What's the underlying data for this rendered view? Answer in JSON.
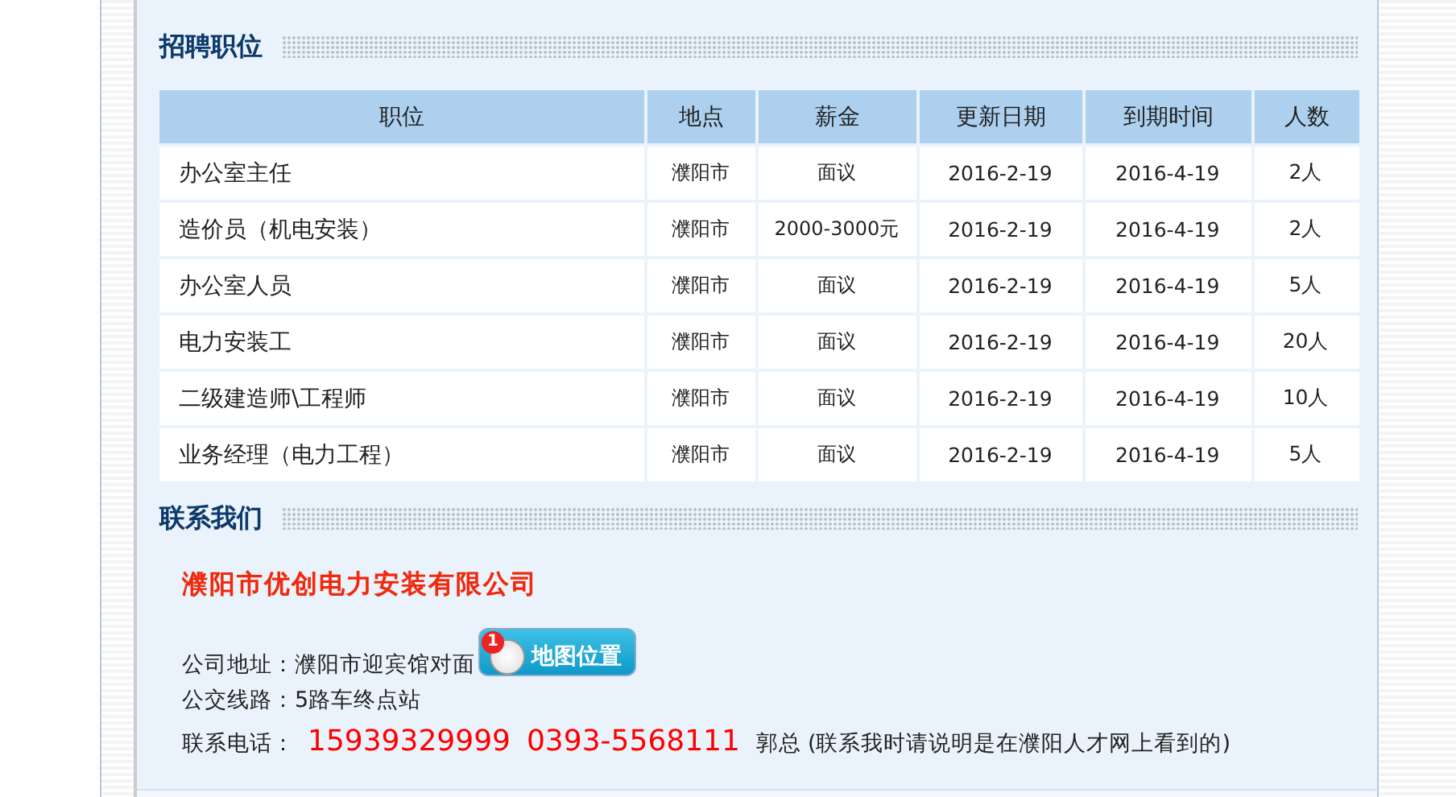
{
  "jobs": {
    "title": "招聘职位",
    "table": {
      "columns": [
        "职位",
        "地点",
        "薪金",
        "更新日期",
        "到期时间",
        "人数"
      ],
      "rows": [
        [
          "办公室主任",
          "濮阳市",
          "面议",
          "2016-2-19",
          "2016-4-19",
          "2人"
        ],
        [
          "造价员（机电安装）",
          "濮阳市",
          "2000-3000元",
          "2016-2-19",
          "2016-4-19",
          "2人"
        ],
        [
          "办公室人员",
          "濮阳市",
          "面议",
          "2016-2-19",
          "2016-4-19",
          "5人"
        ],
        [
          "电力安装工",
          "濮阳市",
          "面议",
          "2016-2-19",
          "2016-4-19",
          "20人"
        ],
        [
          "二级建造师\\工程师",
          "濮阳市",
          "面议",
          "2016-2-19",
          "2016-4-19",
          "10人"
        ],
        [
          "业务经理（电力工程）",
          "濮阳市",
          "面议",
          "2016-2-19",
          "2016-4-19",
          "5人"
        ]
      ]
    }
  },
  "contact": {
    "title": "联系我们",
    "company": "濮阳市优创电力安装有限公司",
    "address_label": "公司地址：",
    "address": "濮阳市迎宾馆对面",
    "map_button": {
      "badge": "1",
      "label": "地图位置"
    },
    "bus_label": "公交线路：",
    "bus": "5路车终点站",
    "phone_label": "联系电话：",
    "phones": [
      "15939329999",
      "0393-5568111"
    ],
    "person": "郭总",
    "note": "(联系我时请说明是在濮阳人才网上看到的)"
  }
}
